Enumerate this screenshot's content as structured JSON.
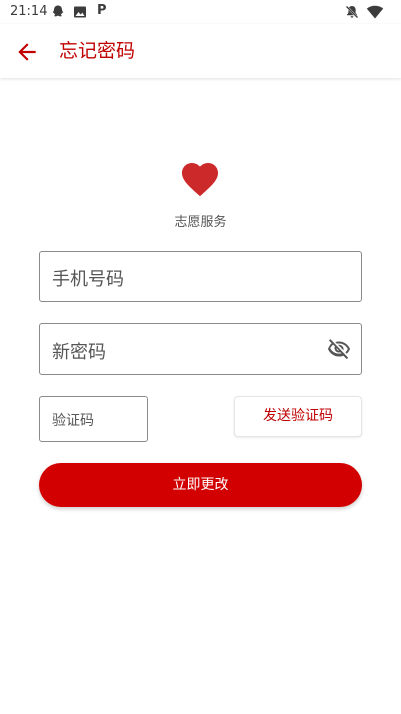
{
  "status_bar": {
    "time": "21:14",
    "p_label": "P",
    "icons": [
      "qq-icon",
      "image-icon",
      "p-icon",
      "bell-off-icon",
      "wifi-icon"
    ]
  },
  "header": {
    "title": "忘记密码"
  },
  "brand": {
    "app_name": "志愿服务",
    "icon": "heart-icon",
    "color": "#cc2a2a"
  },
  "form": {
    "phone_placeholder": "手机号码",
    "password_placeholder": "新密码",
    "code_placeholder": "验证码",
    "send_code_label": "发送验证码",
    "submit_label": "立即更改"
  },
  "colors": {
    "accent": "#c00000",
    "button": "#d20000"
  }
}
